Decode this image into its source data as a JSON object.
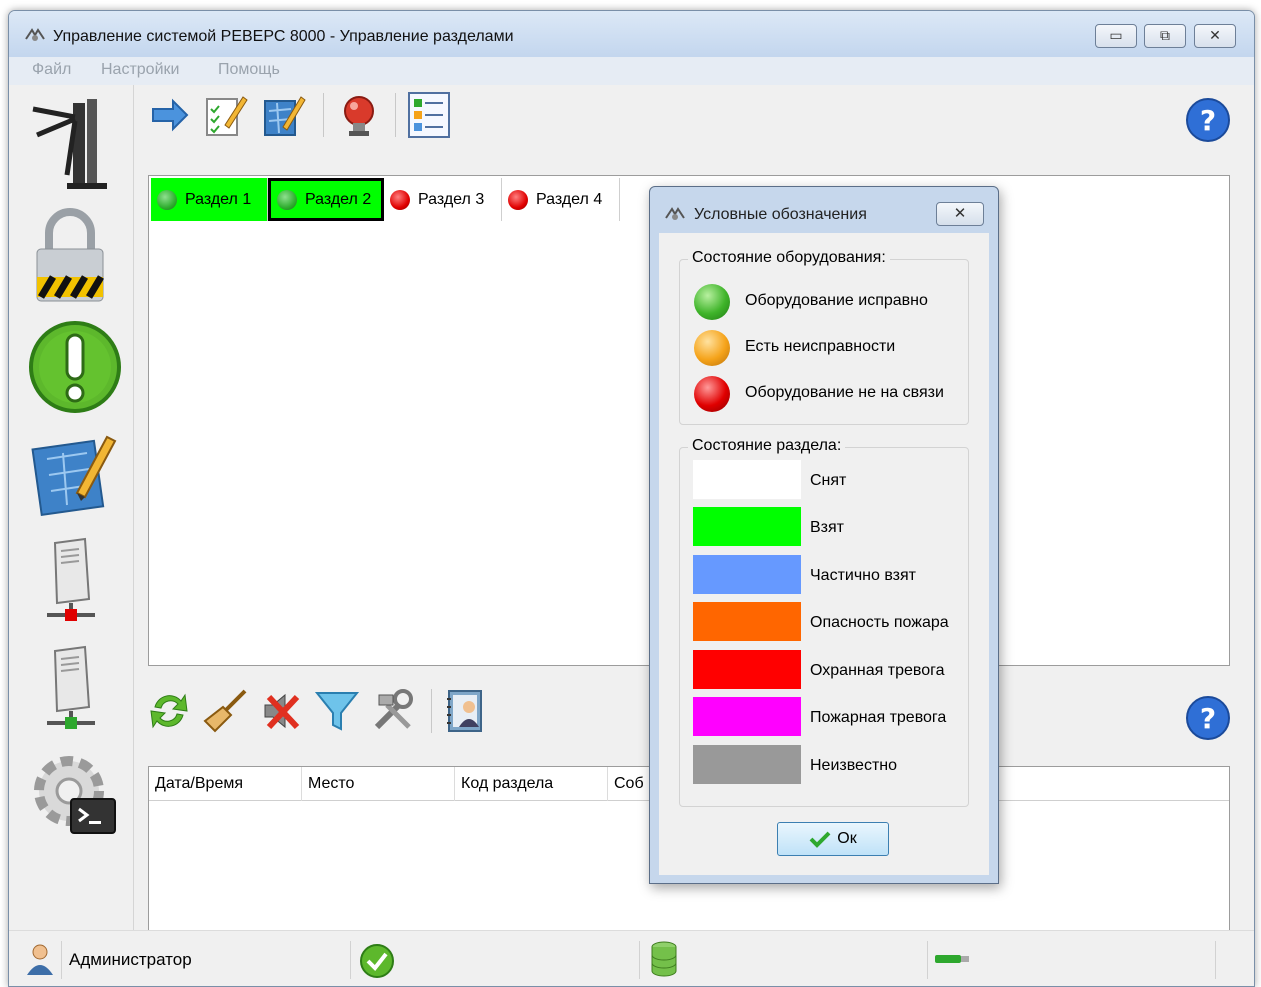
{
  "window": {
    "title": "Управление системой РЕВЕРС 8000 - Управление разделами",
    "controls": {
      "minimize": "▭",
      "maximize": "⧉",
      "close": "✕"
    }
  },
  "menu": {
    "items": [
      "Файл",
      "Настройки",
      "Помощь"
    ]
  },
  "sidebar": {
    "icons": [
      "turnstile-icon",
      "padlock-icon",
      "alert-icon",
      "plan-edit-icon",
      "server-red-icon",
      "server-green-icon",
      "settings-console-icon"
    ]
  },
  "top_toolbar": {
    "buttons": [
      "arrow-right-icon",
      "checklist-edit-icon",
      "plan-edit-icon",
      "siren-icon",
      "legend-list-icon"
    ],
    "help": "?"
  },
  "sections": [
    {
      "label": "Раздел 1",
      "state_color": "#00ff00",
      "dot": "#2fae2f"
    },
    {
      "label": "Раздел 2",
      "state_color": "#00ff00",
      "dot": "#2fae2f"
    },
    {
      "label": "Раздел 3",
      "state_color": "#ffffff",
      "dot": "#e00000"
    },
    {
      "label": "Раздел 4",
      "state_color": "#ffffff",
      "dot": "#e00000"
    }
  ],
  "bottom_toolbar": {
    "buttons": [
      "refresh-icon",
      "broom-icon",
      "mute-icon",
      "filter-icon",
      "tools-icon",
      "contacts-icon"
    ],
    "help": "?"
  },
  "events_table": {
    "columns": [
      "Дата/Время",
      "Место",
      "Код раздела",
      "Соб"
    ]
  },
  "statusbar": {
    "user": "Администратор"
  },
  "dialog": {
    "title": "Условные обозначения",
    "close": "✕",
    "equipment_group": "Состояние оборудования:",
    "equipment_items": [
      {
        "label": "Оборудование исправно",
        "color": "#2ea82e"
      },
      {
        "label": "Есть неисправности",
        "color": "#f5a31a"
      },
      {
        "label": "Оборудование не на связи",
        "color": "#e00000"
      }
    ],
    "section_group": "Состояние раздела:",
    "section_items": [
      {
        "label": "Снят",
        "color": "#ffffff"
      },
      {
        "label": "Взят",
        "color": "#00ff00"
      },
      {
        "label": "Частично взят",
        "color": "#6699ff"
      },
      {
        "label": "Опасность пожара",
        "color": "#ff6600"
      },
      {
        "label": "Охранная тревога",
        "color": "#ff0000"
      },
      {
        "label": "Пожарная тревога",
        "color": "#ff00ff"
      },
      {
        "label": "Неизвестно",
        "color": "#999999"
      }
    ],
    "ok_label": "Ок"
  }
}
